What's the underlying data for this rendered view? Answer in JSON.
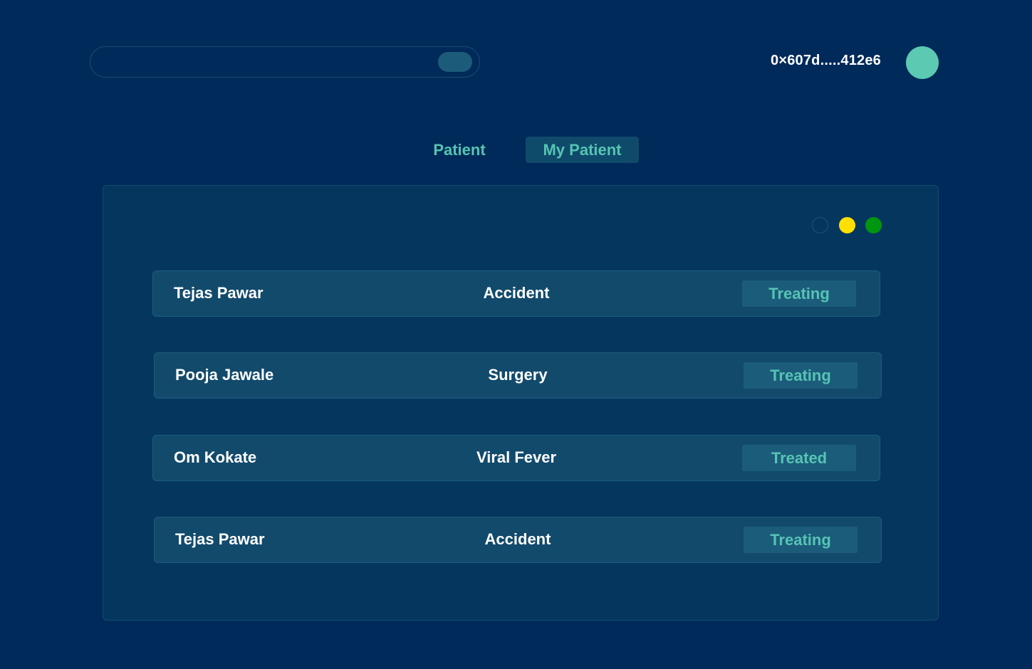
{
  "header": {
    "wallet_address": "0×607d.....412e6"
  },
  "tabs": [
    {
      "label": "Patient"
    },
    {
      "label": "My Patient"
    }
  ],
  "status_colors": {
    "empty": "#002a5a",
    "yellow": "#ffe000",
    "green": "#00960f"
  },
  "patients": [
    {
      "name": "Tejas Pawar",
      "condition": "Accident",
      "status": "Treating"
    },
    {
      "name": "Pooja Jawale",
      "condition": "Surgery",
      "status": "Treating"
    },
    {
      "name": "Om Kokate",
      "condition": "Viral Fever",
      "status": "Treated"
    },
    {
      "name": "Tejas Pawar",
      "condition": "Accident",
      "status": "Treating"
    }
  ]
}
